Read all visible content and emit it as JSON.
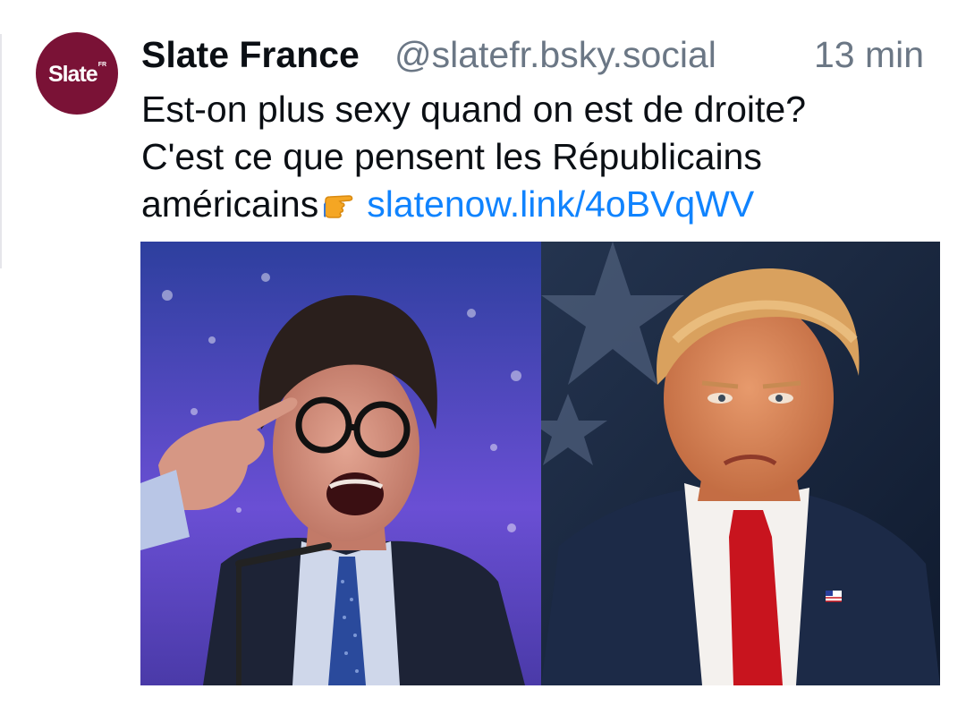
{
  "post": {
    "avatar": {
      "logo_text": "Slate",
      "logo_sup": "FR",
      "background": "#7a1236"
    },
    "author": {
      "display_name": "Slate France",
      "handle": "@slatefr.bsky.social"
    },
    "timestamp": "13 min",
    "text": {
      "line1": "Est-on plus sexy quand on est de droite?",
      "line2": "C'est ce que pensent les Républicains",
      "line3": "américains",
      "emoji": "pointing-right-hand",
      "link": "slatenow.link/4oBVqWV"
    },
    "media": {
      "images": [
        {
          "name": "left-photo"
        },
        {
          "name": "right-photo"
        }
      ]
    },
    "colors": {
      "link": "#1083fe",
      "text": "#0b0f14",
      "muted": "#6b7785"
    }
  }
}
